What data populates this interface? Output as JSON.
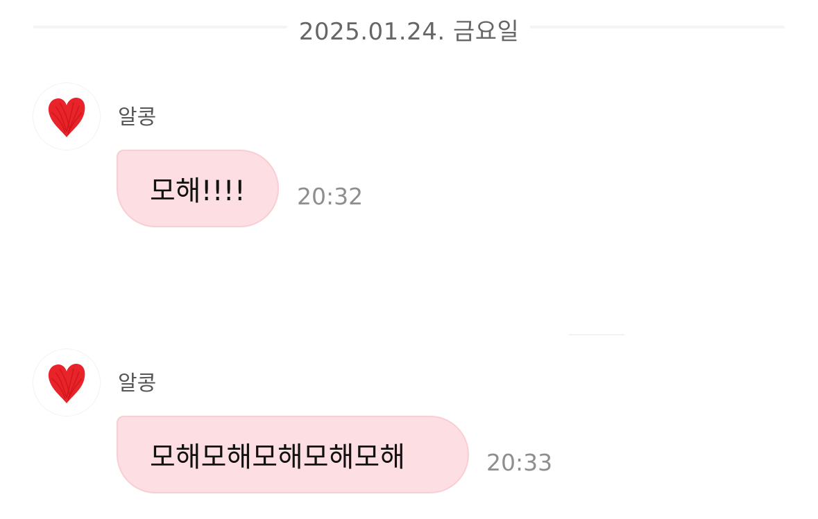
{
  "date_divider": {
    "text": "2025.01.24. 금요일"
  },
  "messages": [
    {
      "sender": "알콩",
      "avatar_icon": "red-heart-icon",
      "text": "모해!!!!",
      "time": "20:32"
    },
    {
      "sender": "알콩",
      "avatar_icon": "red-heart-icon",
      "text": "모해모해모해모해모해",
      "time": "20:33"
    }
  ],
  "colors": {
    "bubble": "#fddfe3",
    "bubble_border": "#f9cdd4",
    "heart": "#e8242a",
    "time_text": "#8e8e8e"
  }
}
